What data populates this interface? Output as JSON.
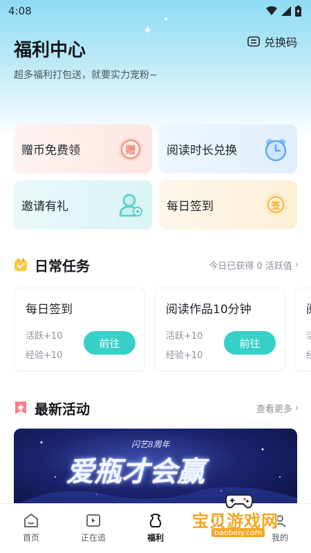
{
  "status_bar": {
    "time": "4:08"
  },
  "header": {
    "title": "福利中心",
    "subtitle": "超多福利打包送，就要实力宠粉~",
    "redeem_label": "兑换码"
  },
  "quick_cards": [
    {
      "label": "赠币免费领",
      "badge": "赠",
      "color": "#f08a76"
    },
    {
      "label": "阅读时长兑换",
      "badge": "alarm-clock",
      "color": "#5aa9f0"
    },
    {
      "label": "邀请有礼",
      "badge": "user-add",
      "color": "#4fd0c8"
    },
    {
      "label": "每日签到",
      "badge": "签",
      "color": "#f5b14a"
    }
  ],
  "daily_tasks": {
    "title": "日常任务",
    "summary": "今日已获得 0 活跃值",
    "items": [
      {
        "title": "每日签到",
        "activity": "活跃+10",
        "exp": "经验+10",
        "button": "前往"
      },
      {
        "title": "阅读作品10分钟",
        "activity": "活跃+10",
        "exp": "经验+10",
        "button": "前往"
      },
      {
        "title": "阅",
        "activity": "活",
        "exp": "经"
      }
    ]
  },
  "latest_events": {
    "title": "最新活动",
    "more": "查看更多",
    "banner": {
      "subtitle": "闪艺8周年",
      "headline": "爱瓶才会赢"
    }
  },
  "tabs": [
    {
      "label": "首页",
      "icon": "home-icon"
    },
    {
      "label": "正在追",
      "icon": "play-icon"
    },
    {
      "label": "福利",
      "icon": "gift-icon",
      "active": true
    },
    {
      "label": "",
      "icon": "community-icon"
    },
    {
      "label": "我的",
      "icon": "profile-icon"
    }
  ],
  "watermark": {
    "text": "宝贝游戏网",
    "url": "baobeiy.com"
  },
  "colors": {
    "accent": "#35d0c8",
    "hero_top": "#8fdcf4"
  }
}
